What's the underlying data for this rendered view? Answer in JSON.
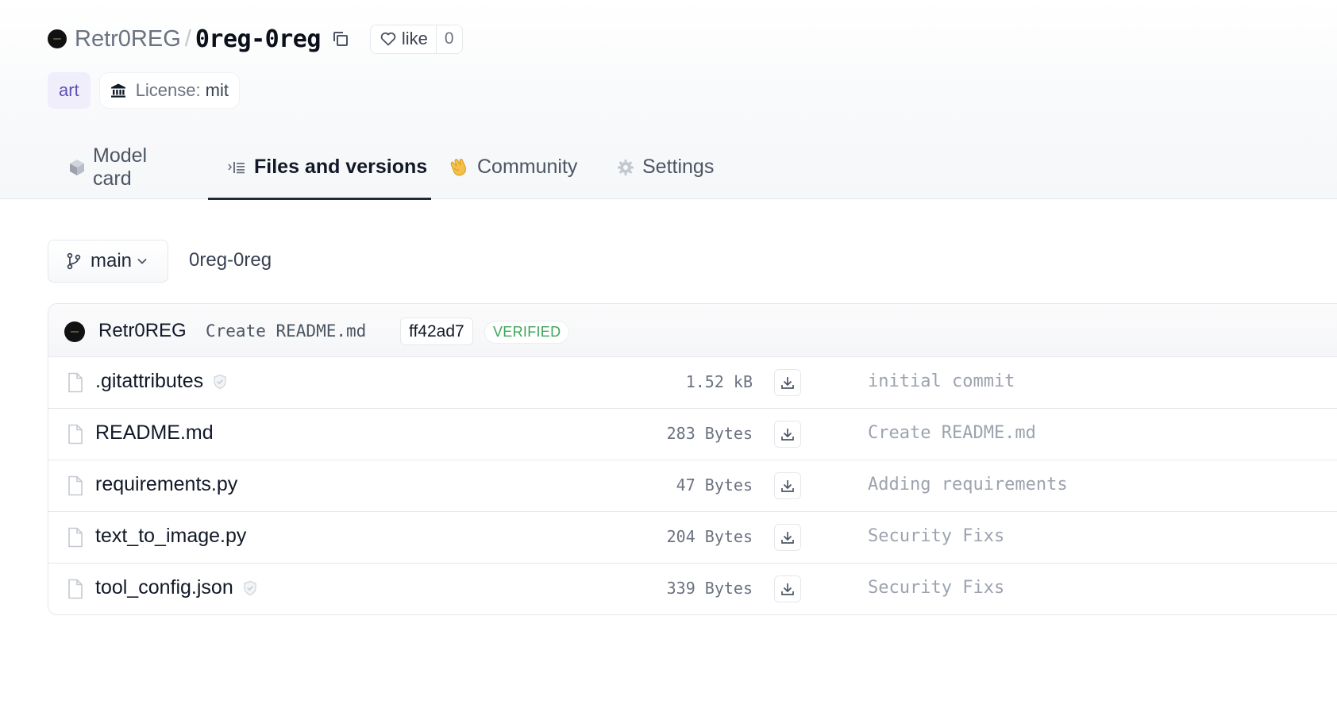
{
  "repo": {
    "owner": "Retr0REG",
    "separator": "/",
    "name": "0reg-0reg",
    "like_label": "like",
    "like_count": "0"
  },
  "tags": {
    "art": "art",
    "license_key": "License:",
    "license_value": "mit"
  },
  "tabs": [
    {
      "label": "Model card",
      "icon": "cube-icon",
      "active": false
    },
    {
      "label": "Files and versions",
      "icon": "files-icon",
      "active": true
    },
    {
      "label": "Community",
      "icon": "clapping-hands-icon",
      "active": false
    },
    {
      "label": "Settings",
      "icon": "gear-icon",
      "active": false
    }
  ],
  "branch": {
    "name": "main",
    "path": "0reg-0reg"
  },
  "last_commit": {
    "author": "Retr0REG",
    "message": "Create README.md",
    "hash": "ff42ad7",
    "status": "VERIFIED"
  },
  "files": [
    {
      "name": ".gitattributes",
      "safe_badge": true,
      "size": "1.52 kB",
      "commit": "initial commit"
    },
    {
      "name": "README.md",
      "safe_badge": false,
      "size": "283 Bytes",
      "commit": "Create README.md"
    },
    {
      "name": "requirements.py",
      "safe_badge": false,
      "size": "47 Bytes",
      "commit": "Adding requirements"
    },
    {
      "name": "text_to_image.py",
      "safe_badge": false,
      "size": "204 Bytes",
      "commit": "Security Fixs"
    },
    {
      "name": "tool_config.json",
      "safe_badge": true,
      "size": "339 Bytes",
      "commit": "Security Fixs"
    }
  ],
  "colors": {
    "accent_tab_underline": "#1f2937",
    "tag_art_bg": "#f1eefc",
    "tag_art_text": "#5b4fb5",
    "verified_green": "#3fa45b"
  }
}
